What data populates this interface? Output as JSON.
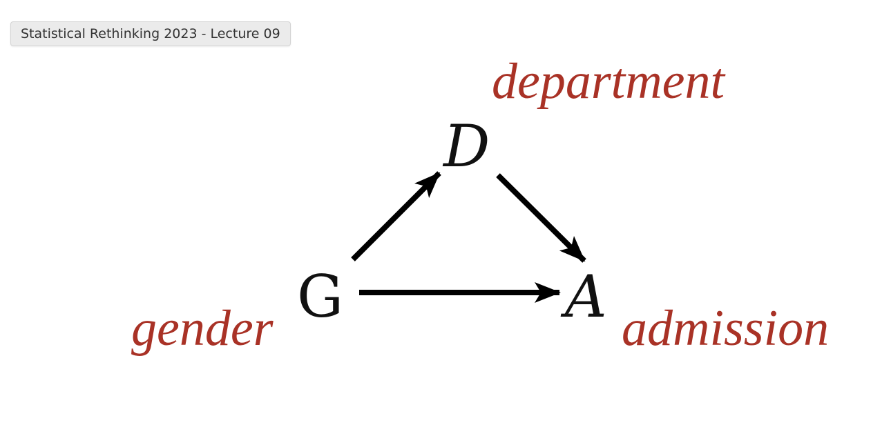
{
  "header": {
    "title": "Statistical Rethinking 2023 - Lecture 09"
  },
  "diagram": {
    "label_color": "#a93226",
    "edge_color": "#000000",
    "nodes": {
      "D": {
        "letter": "D",
        "label": "department"
      },
      "G": {
        "letter": "G",
        "label": "gender"
      },
      "A": {
        "letter": "A",
        "label": "admission"
      }
    },
    "edges": [
      {
        "from": "G",
        "to": "D"
      },
      {
        "from": "D",
        "to": "A"
      },
      {
        "from": "G",
        "to": "A"
      }
    ]
  }
}
